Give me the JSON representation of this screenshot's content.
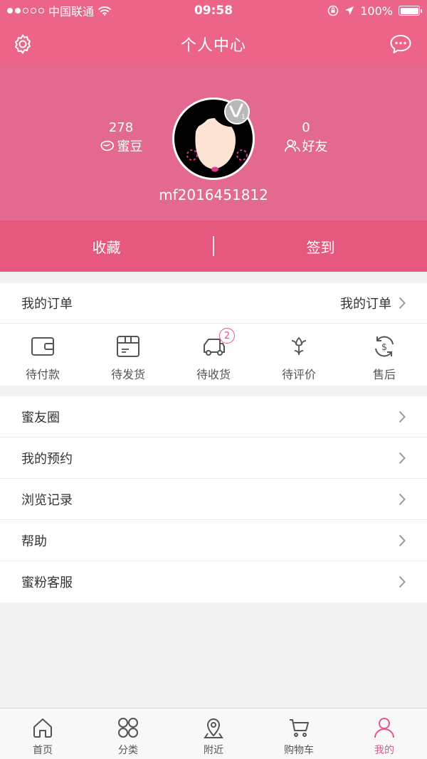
{
  "status_bar": {
    "carrier": "中国联通",
    "time": "09:58",
    "battery": "100%"
  },
  "header": {
    "title": "个人中心",
    "settings_icon": "gear-icon",
    "message_icon": "chat-bubble-icon"
  },
  "profile": {
    "beans_count": "278",
    "beans_label": "蜜豆",
    "friends_count": "0",
    "friends_label": "好友",
    "username": "mf2016451812",
    "vip_level": "1"
  },
  "actions": {
    "favorites": "收藏",
    "checkin": "签到"
  },
  "orders": {
    "title": "我的订单",
    "link": "我的订单",
    "items": [
      {
        "label": "待付款",
        "icon": "wallet-icon"
      },
      {
        "label": "待发货",
        "icon": "package-icon"
      },
      {
        "label": "待收货",
        "icon": "truck-icon",
        "badge": "2"
      },
      {
        "label": "待评价",
        "icon": "flower-icon"
      },
      {
        "label": "售后",
        "icon": "refund-icon"
      }
    ]
  },
  "menu": [
    {
      "label": "蜜友圈"
    },
    {
      "label": "我的预约"
    },
    {
      "label": "浏览记录"
    },
    {
      "label": "帮助"
    },
    {
      "label": "蜜粉客服"
    }
  ],
  "tabbar": [
    {
      "label": "首页",
      "icon": "home-icon"
    },
    {
      "label": "分类",
      "icon": "category-icon"
    },
    {
      "label": "附近",
      "icon": "location-pin-icon"
    },
    {
      "label": "购物车",
      "icon": "cart-icon"
    },
    {
      "label": "我的",
      "icon": "user-icon",
      "active": true
    }
  ],
  "colors": {
    "primary": "#ec6488",
    "profile_bg": "#e4698f",
    "action_bg": "#e7587e",
    "accent": "#e7587e"
  }
}
